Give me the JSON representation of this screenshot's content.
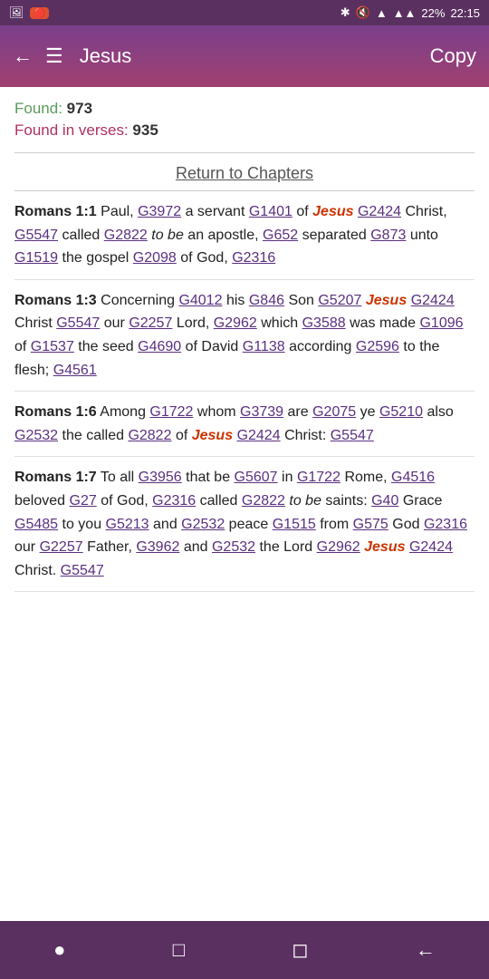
{
  "statusBar": {
    "bluetooth": "BT",
    "mute": "🔇",
    "wifi": "WiFi",
    "signal": "▲▲▲",
    "battery": "22%",
    "time": "22:15"
  },
  "topBar": {
    "title": "Jesus",
    "copyLabel": "Copy"
  },
  "search": {
    "foundLabel": "Found:",
    "foundCount": "973",
    "foundInVersesLabel": "Found in verses:",
    "foundInVersesCount": "935"
  },
  "returnToChapters": "Return to Chapters",
  "verses": [
    {
      "ref": "Romans 1:1",
      "content": " Paul, {G3972} a servant {G1401} of {Jesus} {G2424} Christ, {G5547} called {G2822} {to be} an apostle, {G652} separated {G873} unto {G1519} the gospel {G2098} of God, {G2316}"
    },
    {
      "ref": "Romans 1:3",
      "content": " Concerning {G4012} his {G846} Son {G5207} {Jesus} {G2424} Christ {G5547} our {G2257} Lord, {G2962} which {G3588} was made {G1096} of {G1537} the seed {G4690} of David {G1138} according {G2596} to the flesh; {G4561}"
    },
    {
      "ref": "Romans 1:6",
      "content": " Among {G1722} whom {G3739} are {G2075} ye {G5210} also {G2532} the called {G2822} of {Jesus} {G2424} Christ: {G5547}"
    },
    {
      "ref": "Romans 1:7",
      "content": " To all {G3956} that be {G5607} in {G1722} Rome, {G4516} beloved {G27} of God, {G2316} called {G2822} {to be} saints: {G40} Grace {G5485} to you {G5213} and {G2532} peace {G1515} from {G575} God {G2316} our {G2257} Father, {G3962} and {G2532} the Lord {G2962} {Jesus} {G2424} Christ. {G5547}"
    }
  ]
}
